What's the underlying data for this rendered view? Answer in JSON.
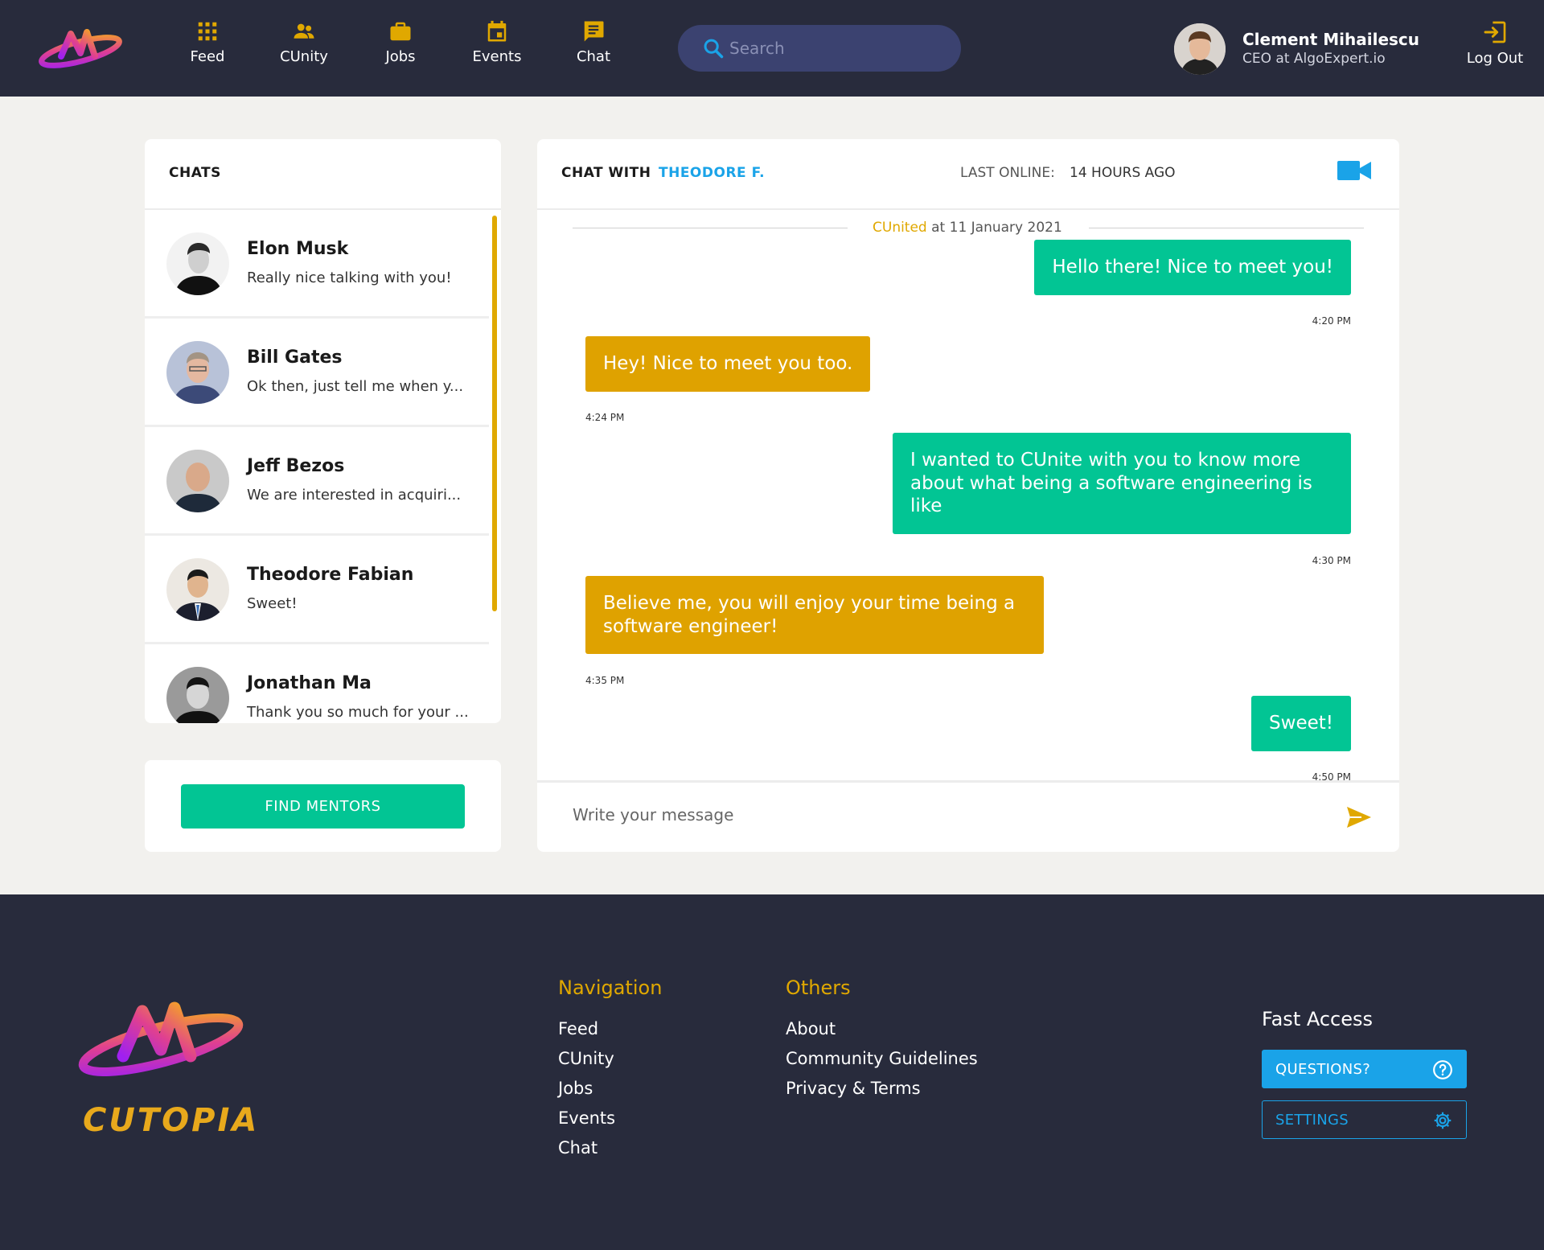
{
  "colors": {
    "header_bg": "#282b3c",
    "accent_gold": "#e0a800",
    "accent_green": "#02c594",
    "accent_blue": "#1aa3e8",
    "page_bg": "#f2f1ee"
  },
  "header": {
    "nav": [
      {
        "label": "Feed",
        "icon": "grid-icon"
      },
      {
        "label": "CUnity",
        "icon": "people-icon"
      },
      {
        "label": "Jobs",
        "icon": "briefcase-icon"
      },
      {
        "label": "Events",
        "icon": "calendar-icon"
      },
      {
        "label": "Chat",
        "icon": "chat-icon"
      }
    ],
    "search": {
      "placeholder": "Search"
    },
    "user": {
      "name": "Clement Mihailescu",
      "role": "CEO at AlgoExpert.io"
    },
    "logout_label": "Log Out"
  },
  "chats": {
    "title": "CHATS",
    "items": [
      {
        "name": "Elon Musk",
        "preview": "Really nice talking with you!"
      },
      {
        "name": "Bill Gates",
        "preview": "Ok then, just tell me when y..."
      },
      {
        "name": "Jeff Bezos",
        "preview": "We are interested in acquiri..."
      },
      {
        "name": "Theodore Fabian",
        "preview": "Sweet!"
      },
      {
        "name": "Jonathan Ma",
        "preview": "Thank you so much for your ..."
      }
    ],
    "find_mentors_label": "FIND MENTORS"
  },
  "conversation": {
    "chat_with_label": "CHAT WITH",
    "contact": "THEODORE F.",
    "last_online_label": "LAST ONLINE:",
    "last_online_value": "14 HOURS AGO",
    "date_separator": {
      "brand": "CUnited",
      "rest": "at 11 January 2021"
    },
    "messages": [
      {
        "direction": "out",
        "text": "Hello there! Nice to meet you!",
        "time": "4:20 PM"
      },
      {
        "direction": "in",
        "text": "Hey! Nice to meet you too.",
        "time": "4:24 PM"
      },
      {
        "direction": "out",
        "text": "I wanted to CUnite with you to know more about what being a software engineering is like",
        "time": "4:30 PM"
      },
      {
        "direction": "in",
        "text": "Believe me, you will enjoy your time being a software engineer!",
        "time": "4:35 PM"
      },
      {
        "direction": "out",
        "text": "Sweet!",
        "time": "4:50 PM"
      }
    ],
    "input_placeholder": "Write your message"
  },
  "footer": {
    "wordmark": "CUTOPIA",
    "navigation": {
      "title": "Navigation",
      "links": [
        "Feed",
        "CUnity",
        "Jobs",
        "Events",
        "Chat"
      ]
    },
    "others": {
      "title": "Others",
      "links": [
        "About",
        "Community Guidelines",
        "Privacy & Terms"
      ]
    },
    "fast_access": {
      "title": "Fast Access",
      "questions_label": "QUESTIONS?",
      "settings_label": "SETTINGS"
    }
  }
}
